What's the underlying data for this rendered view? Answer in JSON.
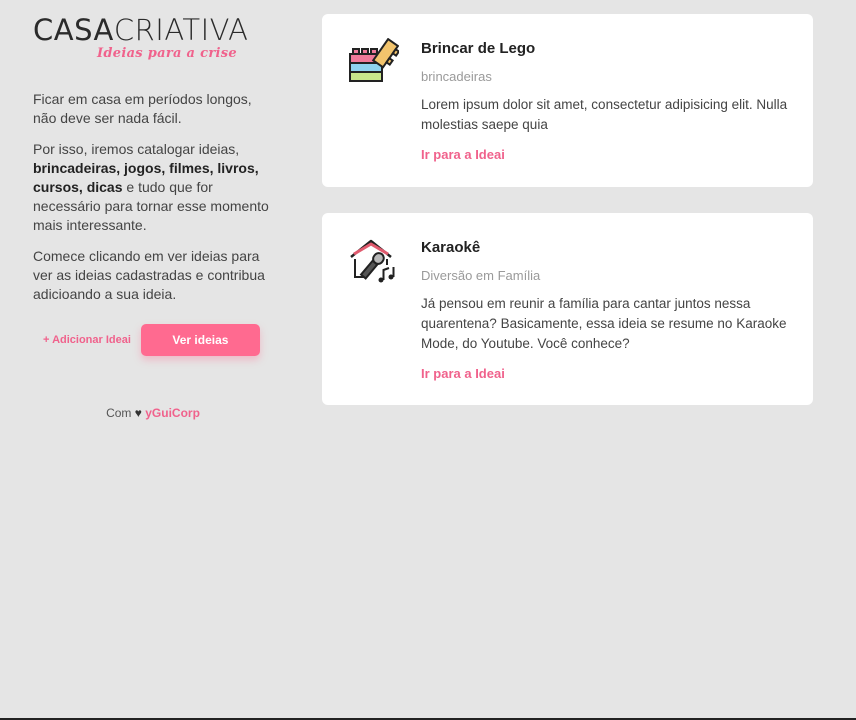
{
  "logo": {
    "main_bold": "CASA",
    "main_thin": "CRIATIVA",
    "tagline": "Ideias para a crise"
  },
  "intro": {
    "p1": "Ficar em casa em períodos longos, não deve ser nada fácil.",
    "p2_start": "Por isso, iremos catalogar ideias, ",
    "p2_bold": "brincadeiras, jogos, filmes, livros, cursos, dicas",
    "p2_end": " e tudo que for necessário para tornar esse momento mais interessante.",
    "p3": "Comece clicando em ver ideias para ver as ideias cadastradas e contribua adicioando a sua ideia."
  },
  "actions": {
    "add_label": "+ Adicionar Ideai",
    "view_label": "Ver ideias"
  },
  "credit": {
    "prefix": "Com",
    "heart": "♥",
    "corp": "yGuiCorp"
  },
  "cards": [
    {
      "icon": "lego-icon",
      "title": "Brincar de Lego",
      "category": "brincadeiras",
      "description": "Lorem ipsum dolor sit amet, consectetur adipisicing elit. Nulla molestias saepe quia",
      "link": "Ir para a Ideai"
    },
    {
      "icon": "karaoke-icon",
      "title": "Karaokê",
      "category": "Diversão em Família",
      "description": "Já pensou em reunir a família para cantar juntos nessa quarentena? Basicamente, essa ideia se resume no Karaoke Mode, do Youtube. Você conhece?",
      "link": "Ir para a Ideai"
    }
  ],
  "colors": {
    "accent": "#ff6a90",
    "background": "#e5e5e5",
    "card": "#ffffff"
  }
}
